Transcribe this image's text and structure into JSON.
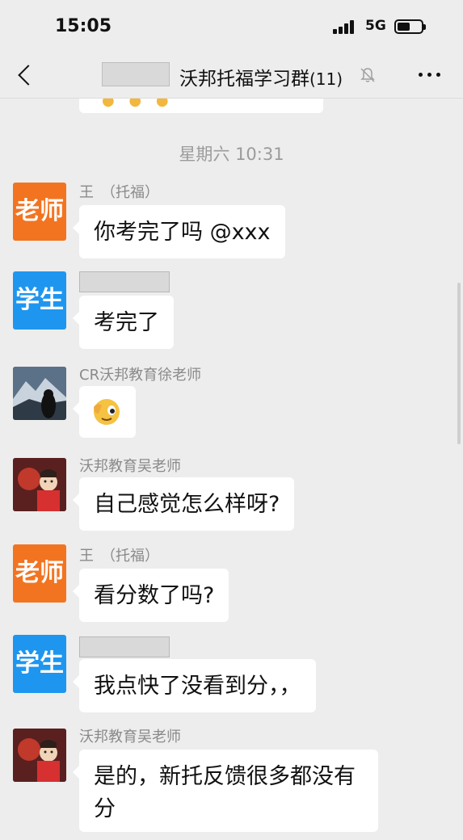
{
  "status": {
    "time": "15:05",
    "network": "5G"
  },
  "header": {
    "title": "沃邦托福学习群",
    "member_count": "(11)"
  },
  "timestamp": "星期六 10:31",
  "avatar_labels": {
    "teacher": "老师",
    "student": "学生"
  },
  "messages": [
    {
      "sender": "王　（托福）",
      "avatar": "老师",
      "text": "你考完了吗 @xxx"
    },
    {
      "sender": "",
      "avatar": "学生",
      "text": "考完了"
    },
    {
      "sender": "CR沃邦教育徐老师",
      "avatar": "photo-mountain",
      "text": ""
    },
    {
      "sender": "沃邦教育吴老师",
      "avatar": "photo-dragon",
      "text": "自己感觉怎么样呀?"
    },
    {
      "sender": "王　（托福）",
      "avatar": "老师",
      "text": "看分数了吗?"
    },
    {
      "sender": "",
      "avatar": "学生",
      "text": "我点快了没看到分，，"
    },
    {
      "sender": "沃邦教育吴老师",
      "avatar": "photo-dragon",
      "text": "是的，新托反馈很多都没有分"
    }
  ],
  "colors": {
    "teacher": "#f27421",
    "student": "#1e96f0",
    "background": "#ededed"
  }
}
